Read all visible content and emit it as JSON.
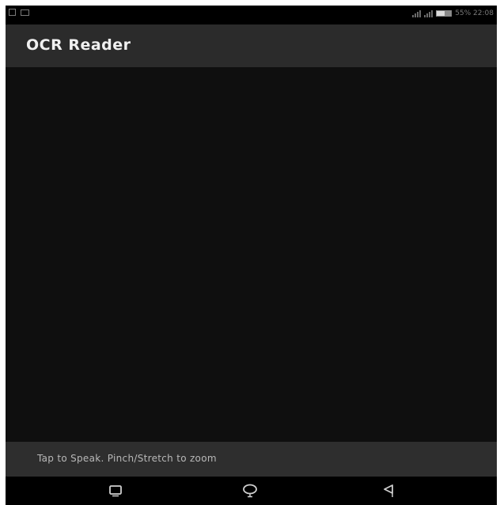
{
  "status_bar": {
    "left_icons": [
      "screenshot-icon",
      "mail-icon"
    ],
    "battery_text": "55% 22:08",
    "battery_level": 0.55
  },
  "app_bar": {
    "title": "OCR Reader"
  },
  "hint_bar": {
    "text": "Tap to Speak. Pinch/Stretch to zoom"
  },
  "nav_bar": {
    "buttons": [
      "recent-apps-icon",
      "home-icon",
      "back-icon"
    ]
  },
  "colors": {
    "status_bar": "#000000",
    "app_bar": "#2b2b2b",
    "camera_preview": "#0f0f0f",
    "hint_bar": "#2e2e2e",
    "nav_bar": "#000000",
    "title_text": "#f0f0f0",
    "hint_text": "#b8b8b8"
  }
}
